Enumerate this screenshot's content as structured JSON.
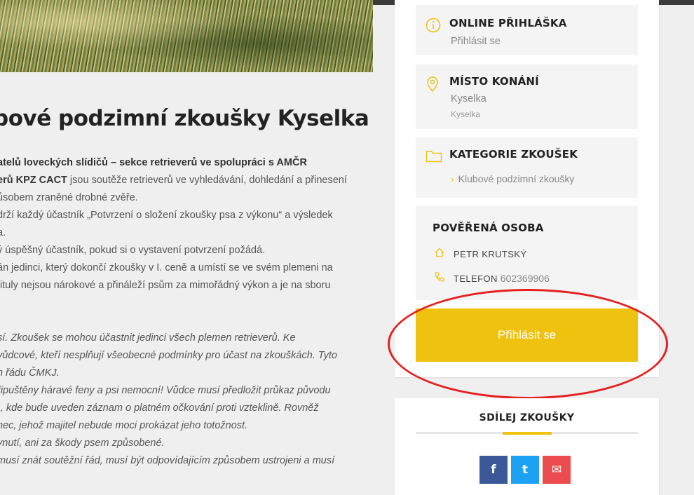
{
  "article": {
    "title": "bové podzimní zkoušky Kyselka",
    "paragraphs": [
      {
        "b": "atelů loveckých slídičů – sekce retrieverů ve spolupráci s AMČR",
        "t": ""
      },
      {
        "b": "erů KPZ CACT",
        "t": " jsou soutěže retrieverů ve vyhledávání, dohledání a přinesení"
      },
      {
        "b": "",
        "t": "ůsobem zraněné drobné zvěře."
      },
      {
        "b": "",
        "t": "drží každý účastník „Potvrzení o složení zkoušky psa z výkonu“ a výsledek"
      },
      {
        "b": "",
        "t": "a."
      },
      {
        "b": "",
        "t": "ý úspěšný účastník, pokud si o vystavení potvrzení požádá."
      },
      {
        "b": "",
        "t": "án jedinci, který dokončí zkoušky v I. ceně a umístí se ve svém plemeni na"
      },
      {
        "b": "",
        "t": " tituly nejsou nárokové a přináleží psům za mimořádný výkon a je na sboru"
      }
    ],
    "italic_lines": [
      "sí. Zkoušek se mohou účastnit jedinci všech plemen retrieverů. Ke",
      "vůdcové, kteří nesplňují všeobecné podmínky pro účast na zkouškách. Tyto",
      "n řádu ČMKJ.",
      "řipuštěny háravé feny a psi nemocní! Vůdce musí předložit průkaz původu",
      "), kde bude uveden záznam o platném očkování proti vzteklině. Rovněž",
      "nec, jehož majitel nebude moci prokázat jeho totožnost.",
      "ynutí, ani za škody psem způsobené.",
      "musí znát soutěžní řád, musí být odpovídajícím způsobem ustrojeni a musí"
    ]
  },
  "sidebar": {
    "online": {
      "heading": "ONLINE PŘIHLÁŠKA",
      "link": "Přihlásit se"
    },
    "venue": {
      "heading": "MÍSTO KONÁNÍ",
      "line1": "Kyselka",
      "line2": "Kyselka"
    },
    "category": {
      "heading": "KATEGORIE ZKOUŠEK",
      "item": "Klubové podzimní zkoušky"
    },
    "contact": {
      "heading": "POVĚŘENÁ OSOBA",
      "name": "PETR KRUTSKÝ",
      "phone_label": "TELEFON",
      "phone": "602369906"
    },
    "cta": "Přihlásit se"
  },
  "share": {
    "title": "SDÍLEJ ZKOUŠKY",
    "buttons": [
      {
        "icon": "facebook-icon",
        "glyph": "f",
        "color": "#3b5998"
      },
      {
        "icon": "twitter-icon",
        "glyph": "t",
        "color": "#1da1f2"
      },
      {
        "icon": "email-icon",
        "glyph": "✉",
        "color": "#ea4c50"
      }
    ]
  },
  "colors": {
    "accent": "#f0c20f",
    "cta": "#f0c210",
    "highlight_ring": "#e42020"
  }
}
